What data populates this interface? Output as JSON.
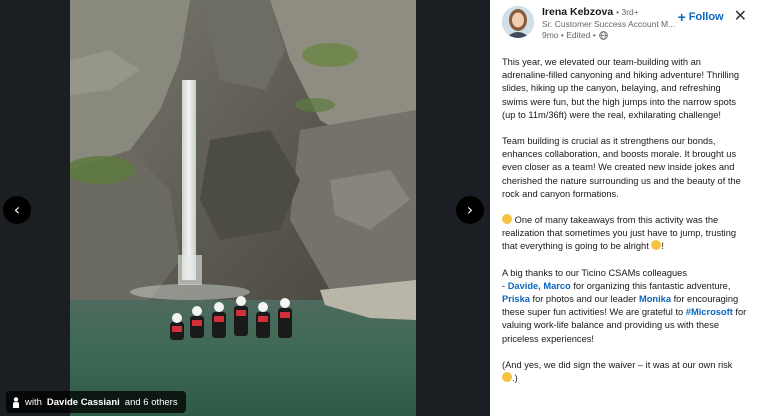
{
  "media": {
    "tag_prefix": "with",
    "tag_name": "Davide Cassiani",
    "tag_suffix": "and 6 others",
    "prev_glyph": "‹",
    "next_glyph": "›"
  },
  "post": {
    "author": "Irena Kebzova",
    "degree": "• 3rd+",
    "headline": "Sr. Customer Success Account M...",
    "time": "9mo • Edited •",
    "follow_label": "Follow",
    "paragraphs": {
      "p1": "This year, we elevated our team-building with an adrenaline-filled canyoning and hiking adventure! Thrilling slides, hiking up the canyon, belaying, and refreshing swims were fun, but the high jumps into the narrow spots (up to 11m/36ft) were the real, exhilarating challenge!",
      "p2": "Team building is crucial as it strengthens our bonds, enhances collaboration, and boosts morale. It brought us even closer as a team! We created new inside jokes and cherished the nature surrounding us and the beauty of the rock and canyon formations.",
      "p3": "One of many takeaways from this activity was the realization that sometimes you just have to jump, trusting that everything is going to be alright",
      "p3_end": "!",
      "p4_a": "A big thanks to our Ticino CSAMs colleagues",
      "p4_b": "- ",
      "p4_m1": "Davide, Marco",
      "p4_c": " for organizing this fantastic adventure, ",
      "p4_m2": "Priska",
      "p4_d": " for photos and our leader ",
      "p4_m3": "Monika",
      "p4_e": " for encouraging these super fun activities! We are grateful to ",
      "p4_m4": "#Microsoft",
      "p4_f": " for valuing work-life balance and providing us with these priceless experiences!",
      "p5": "(And yes, we did sign the waiver – it was at our own risk",
      "p5_end": ".)"
    }
  },
  "colors": {
    "link": "#0a66c2",
    "background": "#1b1f23",
    "panel": "#ffffff"
  }
}
